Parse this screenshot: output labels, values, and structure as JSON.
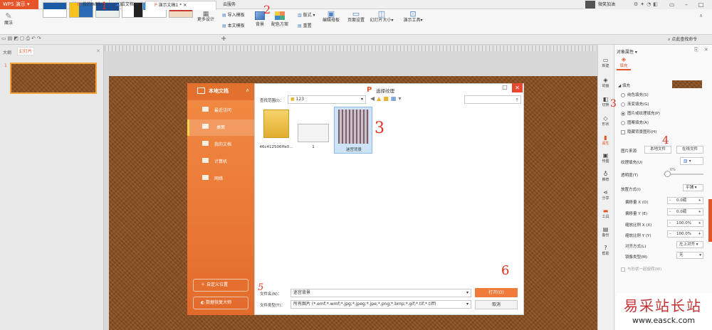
{
  "app": {
    "name": "WPS 演示"
  },
  "menu": [
    "开始",
    "插入",
    "设计",
    "切换",
    "动画",
    "幻灯片放映",
    "审阅",
    "视图",
    "云服务"
  ],
  "user": {
    "name": "微笑加油"
  },
  "ribbon": {
    "magic": "魔法",
    "more_design": "更多设计",
    "import_template": "导入模板",
    "text_template": "本文模板",
    "background": "背景",
    "color_scheme": "配色方案",
    "layout": "版式",
    "reset": "重置",
    "edit_master": "编辑母板",
    "page_setup": "页面设置",
    "slide_size": "幻灯片大小",
    "present_tools": "演示工具"
  },
  "tabs": {
    "my_wps": "我的WPS",
    "cloud_docs": "云文档",
    "doc": "演示文稿1 *",
    "search_placeholder": "点此查找命令"
  },
  "left_panel": {
    "outline": "大纲",
    "slides": "幻灯片",
    "slide_number": "1"
  },
  "dialog": {
    "title": "选择纹理",
    "local_docs": "本地文档",
    "nav": [
      "最近访问",
      "桌面",
      "我的文档",
      "计算机",
      "网络"
    ],
    "custom_location": "自定义位置",
    "data_recovery": "数据恢复大师",
    "look_in_label": "查找范围(I)：",
    "look_in_value": "123",
    "files": [
      "46c412506ffe0...",
      "1",
      "迷宫背景"
    ],
    "filename_label": "文件名(N)：",
    "filename_value": "迷宫背景",
    "filetype_label": "文件类型(T)：",
    "filetype_value": "所有图片 (*.emf;*.wmf;*.jpg;*.jpeg;*.jpe;*.png;*.bmp;*.gif;*.tif;*.tiff)",
    "open_button": "打开(O)",
    "cancel_button": "取消"
  },
  "sidebar": [
    "新建",
    "动画",
    "切换",
    "形状",
    "属性",
    "传图",
    "推荐",
    "分享",
    "工具",
    "备份",
    "帮助"
  ],
  "properties": {
    "title": "对象属性",
    "fill_tab": "填充",
    "fill_section": "填充",
    "fill_options": [
      "纯色填充(S)",
      "渐变填充(G)",
      "图片或纹理填充(P)",
      "图案填充(A)"
    ],
    "hide_bg": "隐藏背景图形(H)",
    "picture_source": "图片来源",
    "local_file": "本地文件",
    "online_file": "在线文件",
    "texture_fill": "纹理填充(U)",
    "transparency": "透明度(T)",
    "transparency_value": "0%",
    "placement": "放置方式(I)",
    "placement_value": "平铺",
    "offset_x": "偏移量 X (O)",
    "offset_x_value": "0.0磅",
    "offset_y": "偏移量 Y (E)",
    "offset_y_value": "0.0磅",
    "scale_x": "缩放比例 X (X)",
    "scale_x_value": "100.0%",
    "scale_y": "缩放比例 Y (Y)",
    "scale_y_value": "100.0%",
    "alignment": "对齐方式(L)",
    "alignment_value": "左上对齐",
    "mirror": "镜像类型(M)",
    "mirror_value": "无",
    "rotate_with": "与形状一起旋转(W)"
  },
  "annotations": [
    "1",
    "2",
    "3",
    "3",
    "4",
    "5",
    "6"
  ],
  "watermark": {
    "title": "易采站长站",
    "url": "www.easck.com"
  },
  "colors": {
    "accent": "#e6552a",
    "dialog_orange": "#ef7d37"
  }
}
